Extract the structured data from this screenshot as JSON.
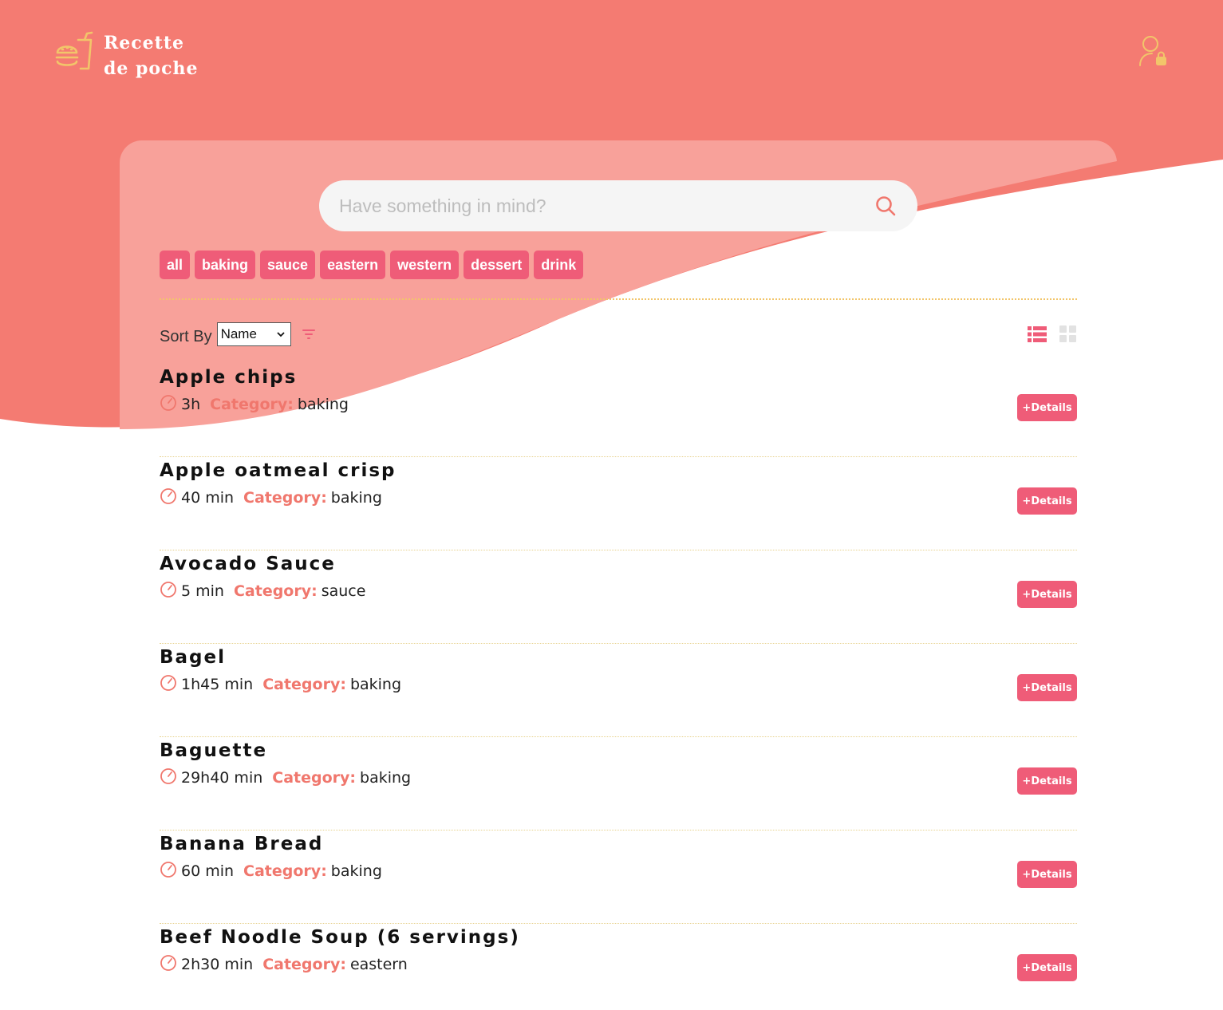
{
  "brand": {
    "line1": "Recette",
    "line2": "de poche",
    "logo_icon": "food-combo-icon",
    "colors": {
      "header": "#f47b72",
      "card_tint": "#f8a19a",
      "accent": "#ef5c78",
      "logo": "#f2c56a"
    }
  },
  "header": {
    "user_icon": "user-lock-icon"
  },
  "search": {
    "placeholder": "Have something in mind?",
    "value": "",
    "icon": "search-icon"
  },
  "filters": [
    "all",
    "baking",
    "sauce",
    "eastern",
    "western",
    "dessert",
    "drink"
  ],
  "sort": {
    "label": "Sort By",
    "selected": "Name",
    "filter_icon": "filter-icon"
  },
  "view": {
    "list_icon": "list-view-icon",
    "grid_icon": "grid-view-icon",
    "active": "list"
  },
  "category_label": "Category:",
  "details_label": "+Details",
  "recipes": [
    {
      "name": "Apple chips",
      "time": "3h",
      "category": "baking"
    },
    {
      "name": "Apple oatmeal crisp",
      "time": "40 min",
      "category": "baking"
    },
    {
      "name": "Avocado Sauce",
      "time": "5 min",
      "category": "sauce"
    },
    {
      "name": "Bagel",
      "time": "1h45 min",
      "category": "baking"
    },
    {
      "name": "Baguette",
      "time": "29h40 min",
      "category": "baking"
    },
    {
      "name": "Banana Bread",
      "time": "60 min",
      "category": "baking"
    },
    {
      "name": "Beef Noodle Soup (6 servings)",
      "time": "2h30 min",
      "category": "eastern"
    }
  ]
}
